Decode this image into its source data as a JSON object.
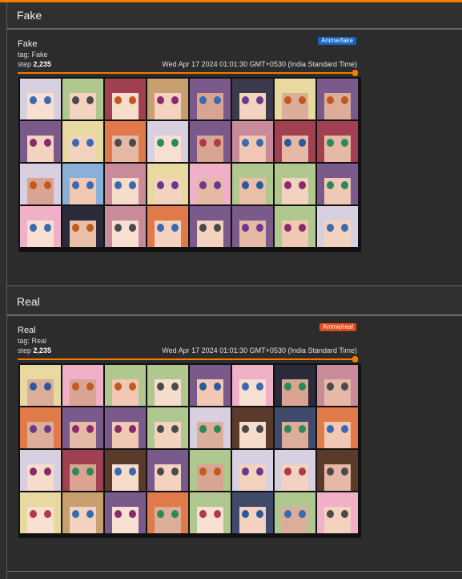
{
  "sections": [
    {
      "header": "Fake",
      "card": {
        "title": "Fake",
        "tag": "tag: Fake",
        "step_label": "step",
        "step_value": "2,235",
        "timestamp": "Wed Apr 17 2024 01:01:30 GMT+0530 (India Standard Time)",
        "badge": "Anime/fake",
        "badge_color": "#1565c0",
        "step_progress": 1.0
      }
    },
    {
      "header": "Real",
      "card": {
        "title": "Real",
        "tag": "tag: Real",
        "step_label": "step",
        "step_value": "2,235",
        "timestamp": "Wed Apr 17 2024 01:01:30 GMT+0530 (India Standard Time)",
        "badge": "Anime/real",
        "badge_color": "#e64a19",
        "step_progress": 1.0
      }
    }
  ],
  "colors": {
    "accent": "#f57c00"
  }
}
